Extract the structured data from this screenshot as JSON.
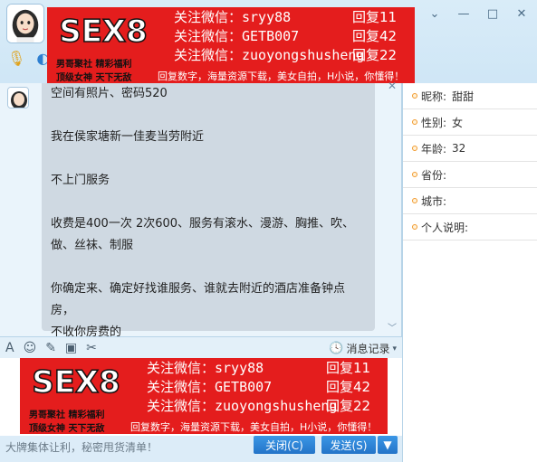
{
  "window": {
    "controls": {
      "pin": "⌄",
      "minimize": "—",
      "maximize": "□",
      "close": "✕"
    }
  },
  "banner": {
    "logo_text": "SEX8",
    "logo_sub_1": "男哥聚社",
    "logo_sub_2": "精彩福利",
    "logo_sub_3": "顶级女神",
    "logo_sub_4": "天下无敌",
    "lines": [
      "关注微信：sryy88",
      "关注微信：GETB007",
      "关注微信：zuoyongshusheng"
    ],
    "replies": [
      "回复11",
      "回复42",
      "回复22"
    ],
    "footer": "回复数字，海量资源下载，美女自拍，H小说，你懂得！"
  },
  "chat": {
    "messages": [
      "空间有照片、密码520",
      "",
      "我在侯家塘新一佳麦当劳附近",
      "",
      "不上门服务",
      "",
      "收费是400一次 2次600、服务有滚水、漫游、胸推、吹、",
      "做、丝袜、制服",
      "",
      "你确定来、确定好找谁服务、谁就去附近的酒店准备钟点房，",
      "不收你房费的"
    ]
  },
  "toolbar": {
    "font_icon": "A",
    "emoji_icon": "☺",
    "edit_icon": "✎",
    "image_icon": "▣",
    "screenshot_icon": "✂",
    "message_log": "消息记录"
  },
  "bottom": {
    "tip": "大牌集体让利，秘密甩货清单！",
    "close_label": "关闭(C)",
    "send_label": "发送(S)",
    "drop_label": "▼"
  },
  "profile": {
    "fields": [
      {
        "label": "昵称:",
        "value": "甜甜"
      },
      {
        "label": "性别:",
        "value": "女"
      },
      {
        "label": "年龄:",
        "value": "32"
      },
      {
        "label": "省份:",
        "value": ""
      },
      {
        "label": "城市:",
        "value": ""
      },
      {
        "label": "个人说明:",
        "value": ""
      }
    ]
  }
}
